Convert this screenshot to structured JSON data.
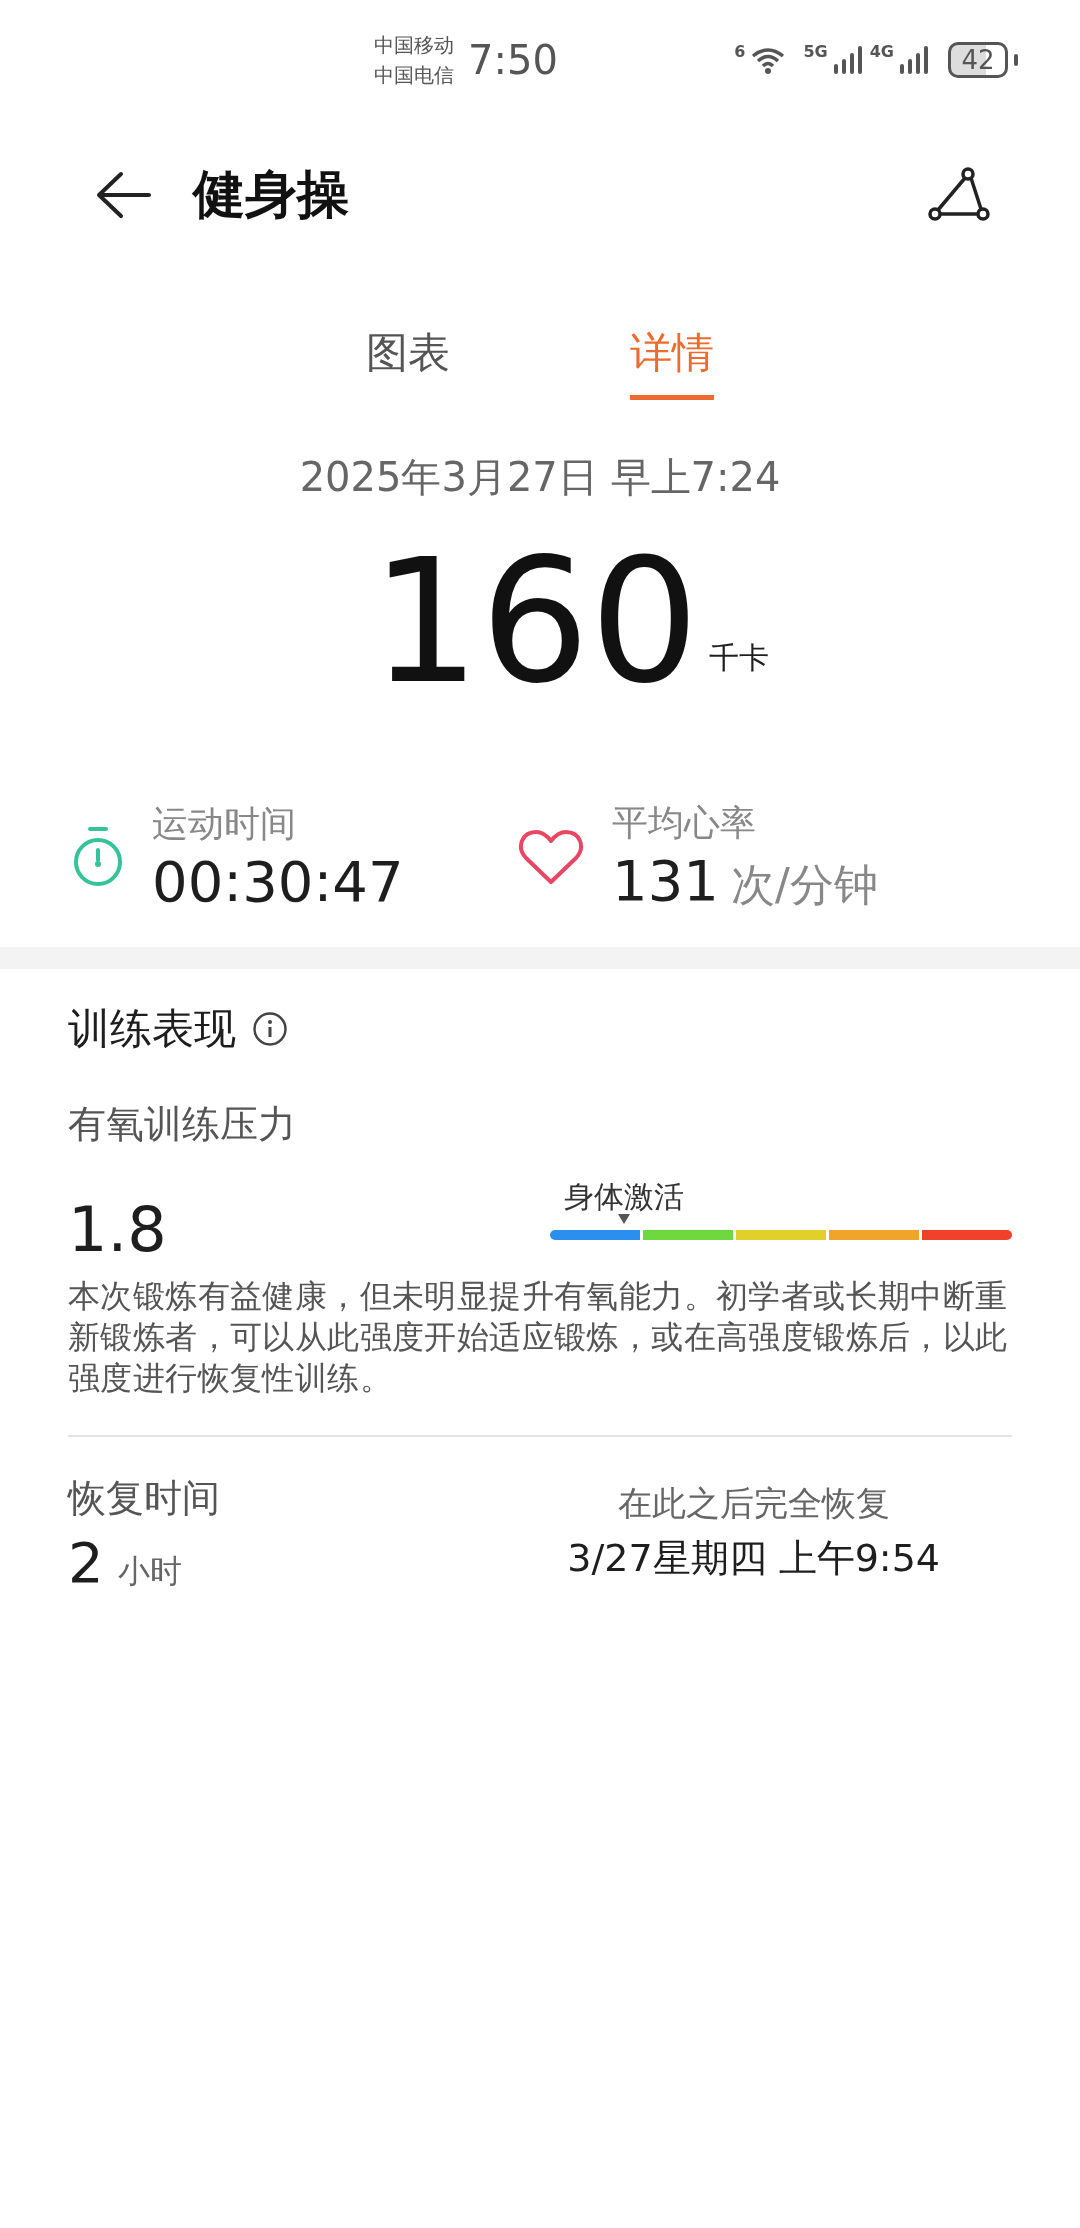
{
  "status_bar": {
    "carriers": [
      "中国移动",
      "中国电信"
    ],
    "time": "7:50",
    "wifi_label": "6",
    "networks": [
      {
        "label": "5G"
      },
      {
        "label": "4G"
      }
    ],
    "battery": "42"
  },
  "header": {
    "title": "健身操"
  },
  "tabs": [
    {
      "label": "图表",
      "selected": false
    },
    {
      "label": "详情",
      "selected": true
    }
  ],
  "summary": {
    "date": "2025年3月27日 早上7:24",
    "calories": "160",
    "calories_unit": "千卡"
  },
  "stats": [
    {
      "kind": "timer",
      "label": "运动时间",
      "value": "00:30:47"
    },
    {
      "kind": "heart",
      "label": "平均心率",
      "value": "131",
      "unit": "次/分钟"
    }
  ],
  "performance": {
    "title": "训练表现",
    "aerobic": {
      "label": "有氧训练压力",
      "value": "1.8",
      "marker_label": "身体激活",
      "segments": [
        {
          "color": "#2b8ff0"
        },
        {
          "color": "#6fd83f"
        },
        {
          "color": "#e2cf2a"
        },
        {
          "color": "#f0a52a"
        },
        {
          "color": "#f2412b"
        }
      ],
      "description": "本次锻炼有益健康，但未明显提升有氧能力。初学者或长期中断重新锻炼者，可以从此强度开始适应锻炼，或在高强度锻炼后，以此强度进行恢复性训练。"
    },
    "recovery": {
      "label": "恢复时间",
      "value": "2",
      "unit": "小时",
      "until_label": "在此之后完全恢复",
      "until_time": "3/27星期四 上午9:54"
    }
  }
}
